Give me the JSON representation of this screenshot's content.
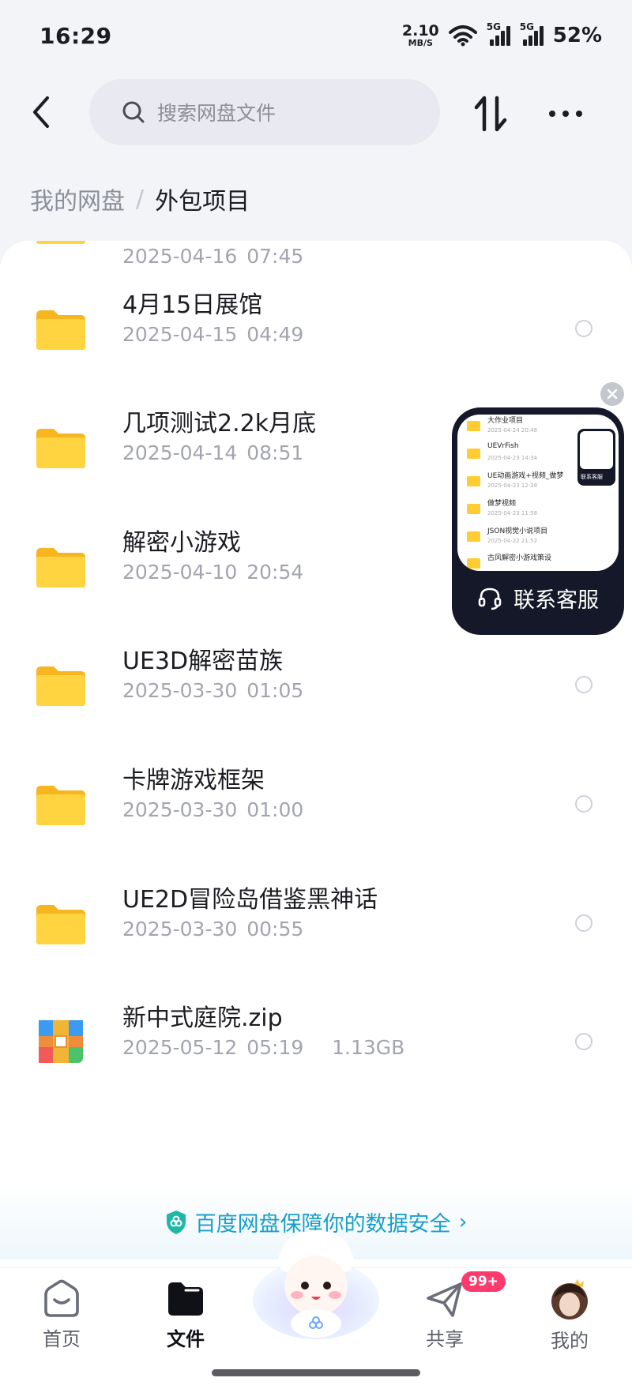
{
  "status": {
    "time": "16:29",
    "net_speed_value": "2.10",
    "net_speed_unit": "MB/S",
    "sim1": "5G",
    "sim2": "5G",
    "battery": "52%"
  },
  "header": {
    "search_placeholder": "搜索网盘文件",
    "back_icon": "chevron-left-icon",
    "sort_icon": "sort-arrows-icon",
    "more_icon": "more-horizontal-icon"
  },
  "breadcrumb": {
    "root": "我的网盘",
    "separator": "/",
    "current": "外包项目"
  },
  "files": [
    {
      "name": "",
      "date": "2025-04-16  07:45",
      "type": "folder"
    },
    {
      "name": "4月15日展馆",
      "date": "2025-04-15  04:49",
      "type": "folder"
    },
    {
      "name": "几项测试2.2k月底",
      "date": "2025-04-14  08:51",
      "type": "folder"
    },
    {
      "name": "解密小游戏",
      "date": "2025-04-10  20:54",
      "type": "folder"
    },
    {
      "name": "UE3D解密苗族",
      "date": "2025-03-30  01:05",
      "type": "folder"
    },
    {
      "name": "卡牌游戏框架",
      "date": "2025-03-30  01:00",
      "type": "folder"
    },
    {
      "name": "UE2D冒险岛借鉴黑神话",
      "date": "2025-03-30  00:55",
      "type": "folder"
    },
    {
      "name": "新中式庭院.zip",
      "date": "2025-05-12  05:19",
      "size": "1.13GB",
      "type": "zip"
    }
  ],
  "security_banner": {
    "text": "百度网盘保障你的数据安全",
    "chevron": "›"
  },
  "float_cs": {
    "label": "联系客服",
    "preview_items": [
      {
        "name": "大作业项目",
        "date": "2025-04-24  20:48"
      },
      {
        "name": "UEVrFish",
        "date": "2025-04-23  14:34"
      },
      {
        "name": "UE动画游戏+视频_做梦",
        "date": "2025-04-23  12:38"
      },
      {
        "name": "做梦视频",
        "date": "2025-04-23  11:58"
      },
      {
        "name": "JSON视觉小说项目",
        "date": "2025-04-22  21:52"
      },
      {
        "name": "古风解密小游戏策设",
        "date": ""
      }
    ],
    "mini_label": "联系客服"
  },
  "bottom_nav": {
    "home": "首页",
    "files": "文件",
    "share": "共享",
    "share_badge": "99+",
    "mine": "我的"
  },
  "colors": {
    "accent_teal": "#1a9fc9",
    "folder_yellow": "#ffcc33",
    "badge_red": "#ff3b6e",
    "float_bg": "#141828"
  }
}
